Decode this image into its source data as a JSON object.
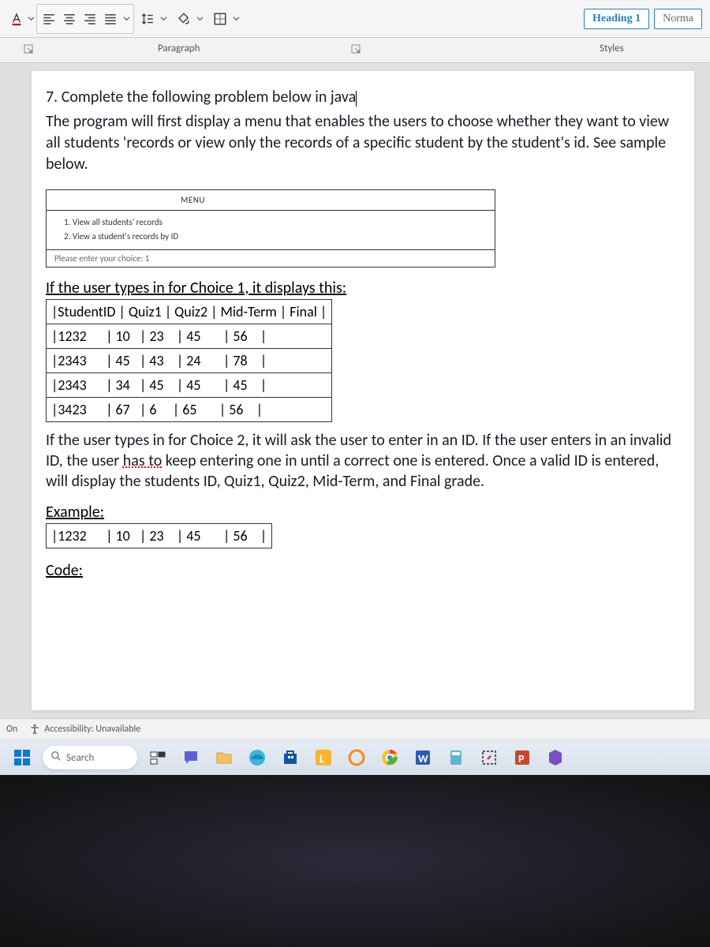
{
  "ribbon": {
    "paragraph_label": "Paragraph",
    "styles_label": "Styles",
    "heading1_label": "Heading 1",
    "normal_label": "Norma"
  },
  "doc": {
    "q_num": "7.",
    "q_title": " Complete the following problem below in java",
    "q_body": "The program will first display a menu that enables the users to choose whether they want to view all students 'records or view only the records of a specific student by the student's id. See sample below.",
    "menu_header": "MENU",
    "menu_item1": "1. View all students' records",
    "menu_item2": "2. View a student's records by ID",
    "menu_prompt": "Please enter your choice: 1",
    "choice1_lead": "If the user types in for Choice 1, it displays this:",
    "table_header": "|StudentID | Quiz1 | Quiz2 | Mid-Term | Final |",
    "rows": [
      "|1232      | 10   | 23    | 45       | 56    |",
      "|2343      | 45   | 43    | 24       | 78    |",
      "|2343      | 34   | 45    | 45       | 45    |",
      "|3423      | 67   | 6     | 65       | 56    |"
    ],
    "choice2_body_a": "If the user types in for Choice 2, it will ask the user to enter in an ID. If the user enters in an invalid ID, the user ",
    "choice2_dotted": "has to",
    "choice2_body_b": " keep entering one in until a correct one is entered. Once a valid ID is entered, will display the students ID, Quiz1, Quiz2, Mid-Term, and Final grade.",
    "example_label": "Example:",
    "example_row": "|1232      | 10   | 23    | 45       | 56    |",
    "code_label": "Code:"
  },
  "status": {
    "on": "On",
    "accessibility": "Accessibility: Unavailable"
  },
  "taskbar": {
    "search_placeholder": "Search"
  }
}
